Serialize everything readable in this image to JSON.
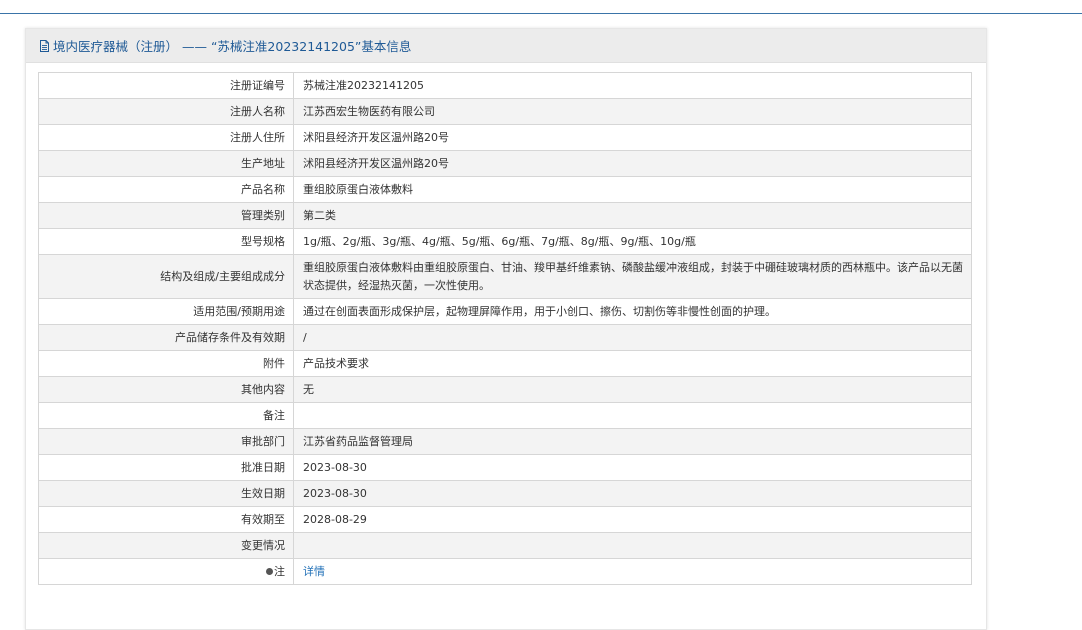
{
  "header": {
    "title": "境内医疗器械（注册） —— “苏械注准20232141205”基本信息"
  },
  "rows": [
    {
      "label": "注册证编号",
      "value": "苏械注准20232141205"
    },
    {
      "label": "注册人名称",
      "value": "江苏西宏生物医药有限公司"
    },
    {
      "label": "注册人住所",
      "value": "沭阳县经济开发区温州路20号"
    },
    {
      "label": "生产地址",
      "value": "沭阳县经济开发区温州路20号"
    },
    {
      "label": "产品名称",
      "value": "重组胶原蛋白液体敷料"
    },
    {
      "label": "管理类别",
      "value": "第二类"
    },
    {
      "label": "型号规格",
      "value": "1g/瓶、2g/瓶、3g/瓶、4g/瓶、5g/瓶、6g/瓶、7g/瓶、8g/瓶、9g/瓶、10g/瓶"
    },
    {
      "label": "结构及组成/主要组成成分",
      "value": "重组胶原蛋白液体敷料由重组胶原蛋白、甘油、羧甲基纤维素钠、磷酸盐缓冲液组成，封装于中硼硅玻璃材质的西林瓶中。该产品以无菌状态提供，经湿热灭菌，一次性使用。"
    },
    {
      "label": "适用范围/预期用途",
      "value": "通过在创面表面形成保护层，起物理屏障作用，用于小创口、擦伤、切割伤等非慢性创面的护理。"
    },
    {
      "label": "产品储存条件及有效期",
      "value": "/"
    },
    {
      "label": "附件",
      "value": "产品技术要求"
    },
    {
      "label": "其他内容",
      "value": "无"
    },
    {
      "label": "备注",
      "value": ""
    },
    {
      "label": "审批部门",
      "value": "江苏省药品监督管理局"
    },
    {
      "label": "批准日期",
      "value": "2023-08-30"
    },
    {
      "label": "生效日期",
      "value": "2023-08-30"
    },
    {
      "label": "有效期至",
      "value": "2028-08-29"
    },
    {
      "label": "变更情况",
      "value": ""
    },
    {
      "label": "注",
      "value": "详情"
    }
  ],
  "icons": {
    "header_icon": "document-icon",
    "note_icon": "dot-icon"
  },
  "colors": {
    "accent": "#1f5a96",
    "link": "#1f6fb7",
    "rule": "#3a74a8"
  }
}
